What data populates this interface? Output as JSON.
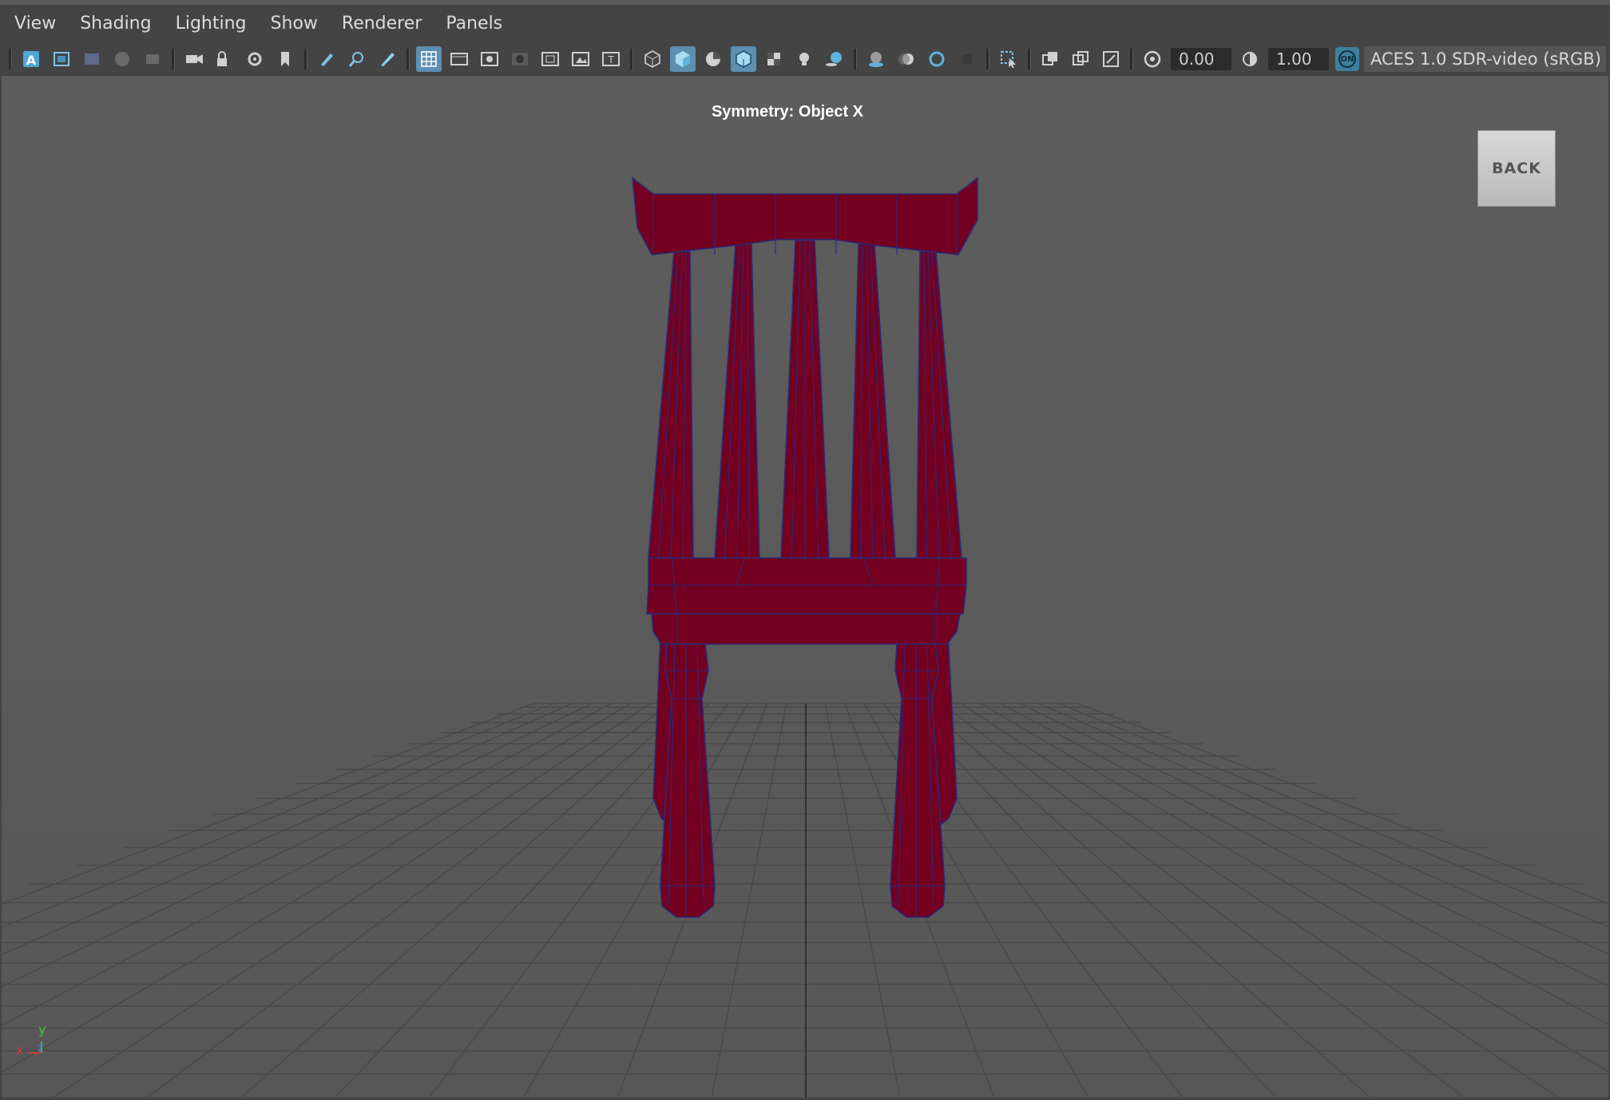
{
  "menubar": {
    "items": [
      "View",
      "Shading",
      "Lighting",
      "Show",
      "Renderer",
      "Panels"
    ]
  },
  "toolbar": {
    "exposure_value": "0.00",
    "gamma_value": "1.00",
    "view_transform_toggle": "ON",
    "color_space": "ACES 1.0 SDR-video (sRGB)"
  },
  "viewport": {
    "symmetry_label": "Symmetry: Object X",
    "back_button_label": "BACK",
    "model_color": "#730020",
    "wire_color": "#2a2a78",
    "grid_color": "#474747"
  },
  "axis_gizmo": {
    "y_label": "y",
    "x_label": "x",
    "z_label": "z"
  }
}
